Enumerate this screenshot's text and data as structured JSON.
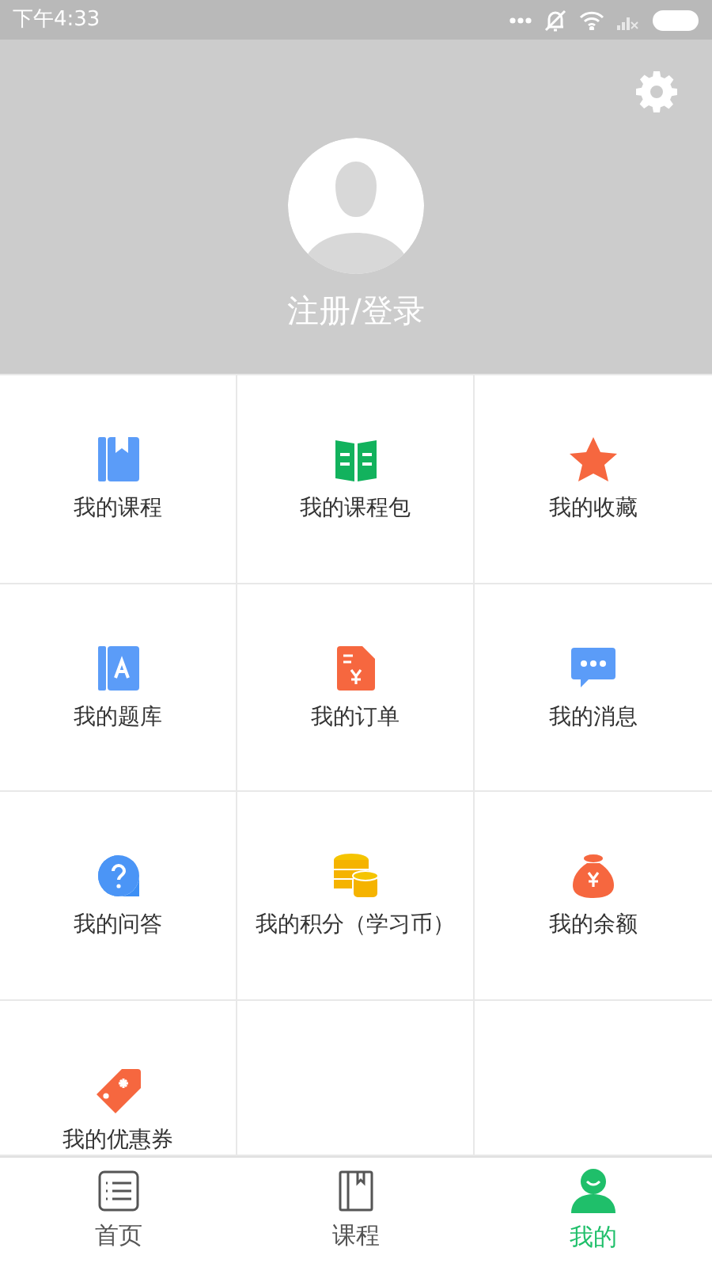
{
  "status_bar": {
    "time": "下午4:33"
  },
  "profile": {
    "login_label": "注册/登录"
  },
  "menu": [
    {
      "label": "我的课程"
    },
    {
      "label": "我的课程包"
    },
    {
      "label": "我的收藏"
    },
    {
      "label": "我的题库"
    },
    {
      "label": "我的订单"
    },
    {
      "label": "我的消息"
    },
    {
      "label": "我的问答"
    },
    {
      "label": "我的积分（学习币）"
    },
    {
      "label": "我的余额"
    },
    {
      "label": "我的优惠券"
    }
  ],
  "tabs": [
    {
      "label": "首页",
      "selected": false
    },
    {
      "label": "课程",
      "selected": false
    },
    {
      "label": "我的",
      "selected": true
    }
  ]
}
